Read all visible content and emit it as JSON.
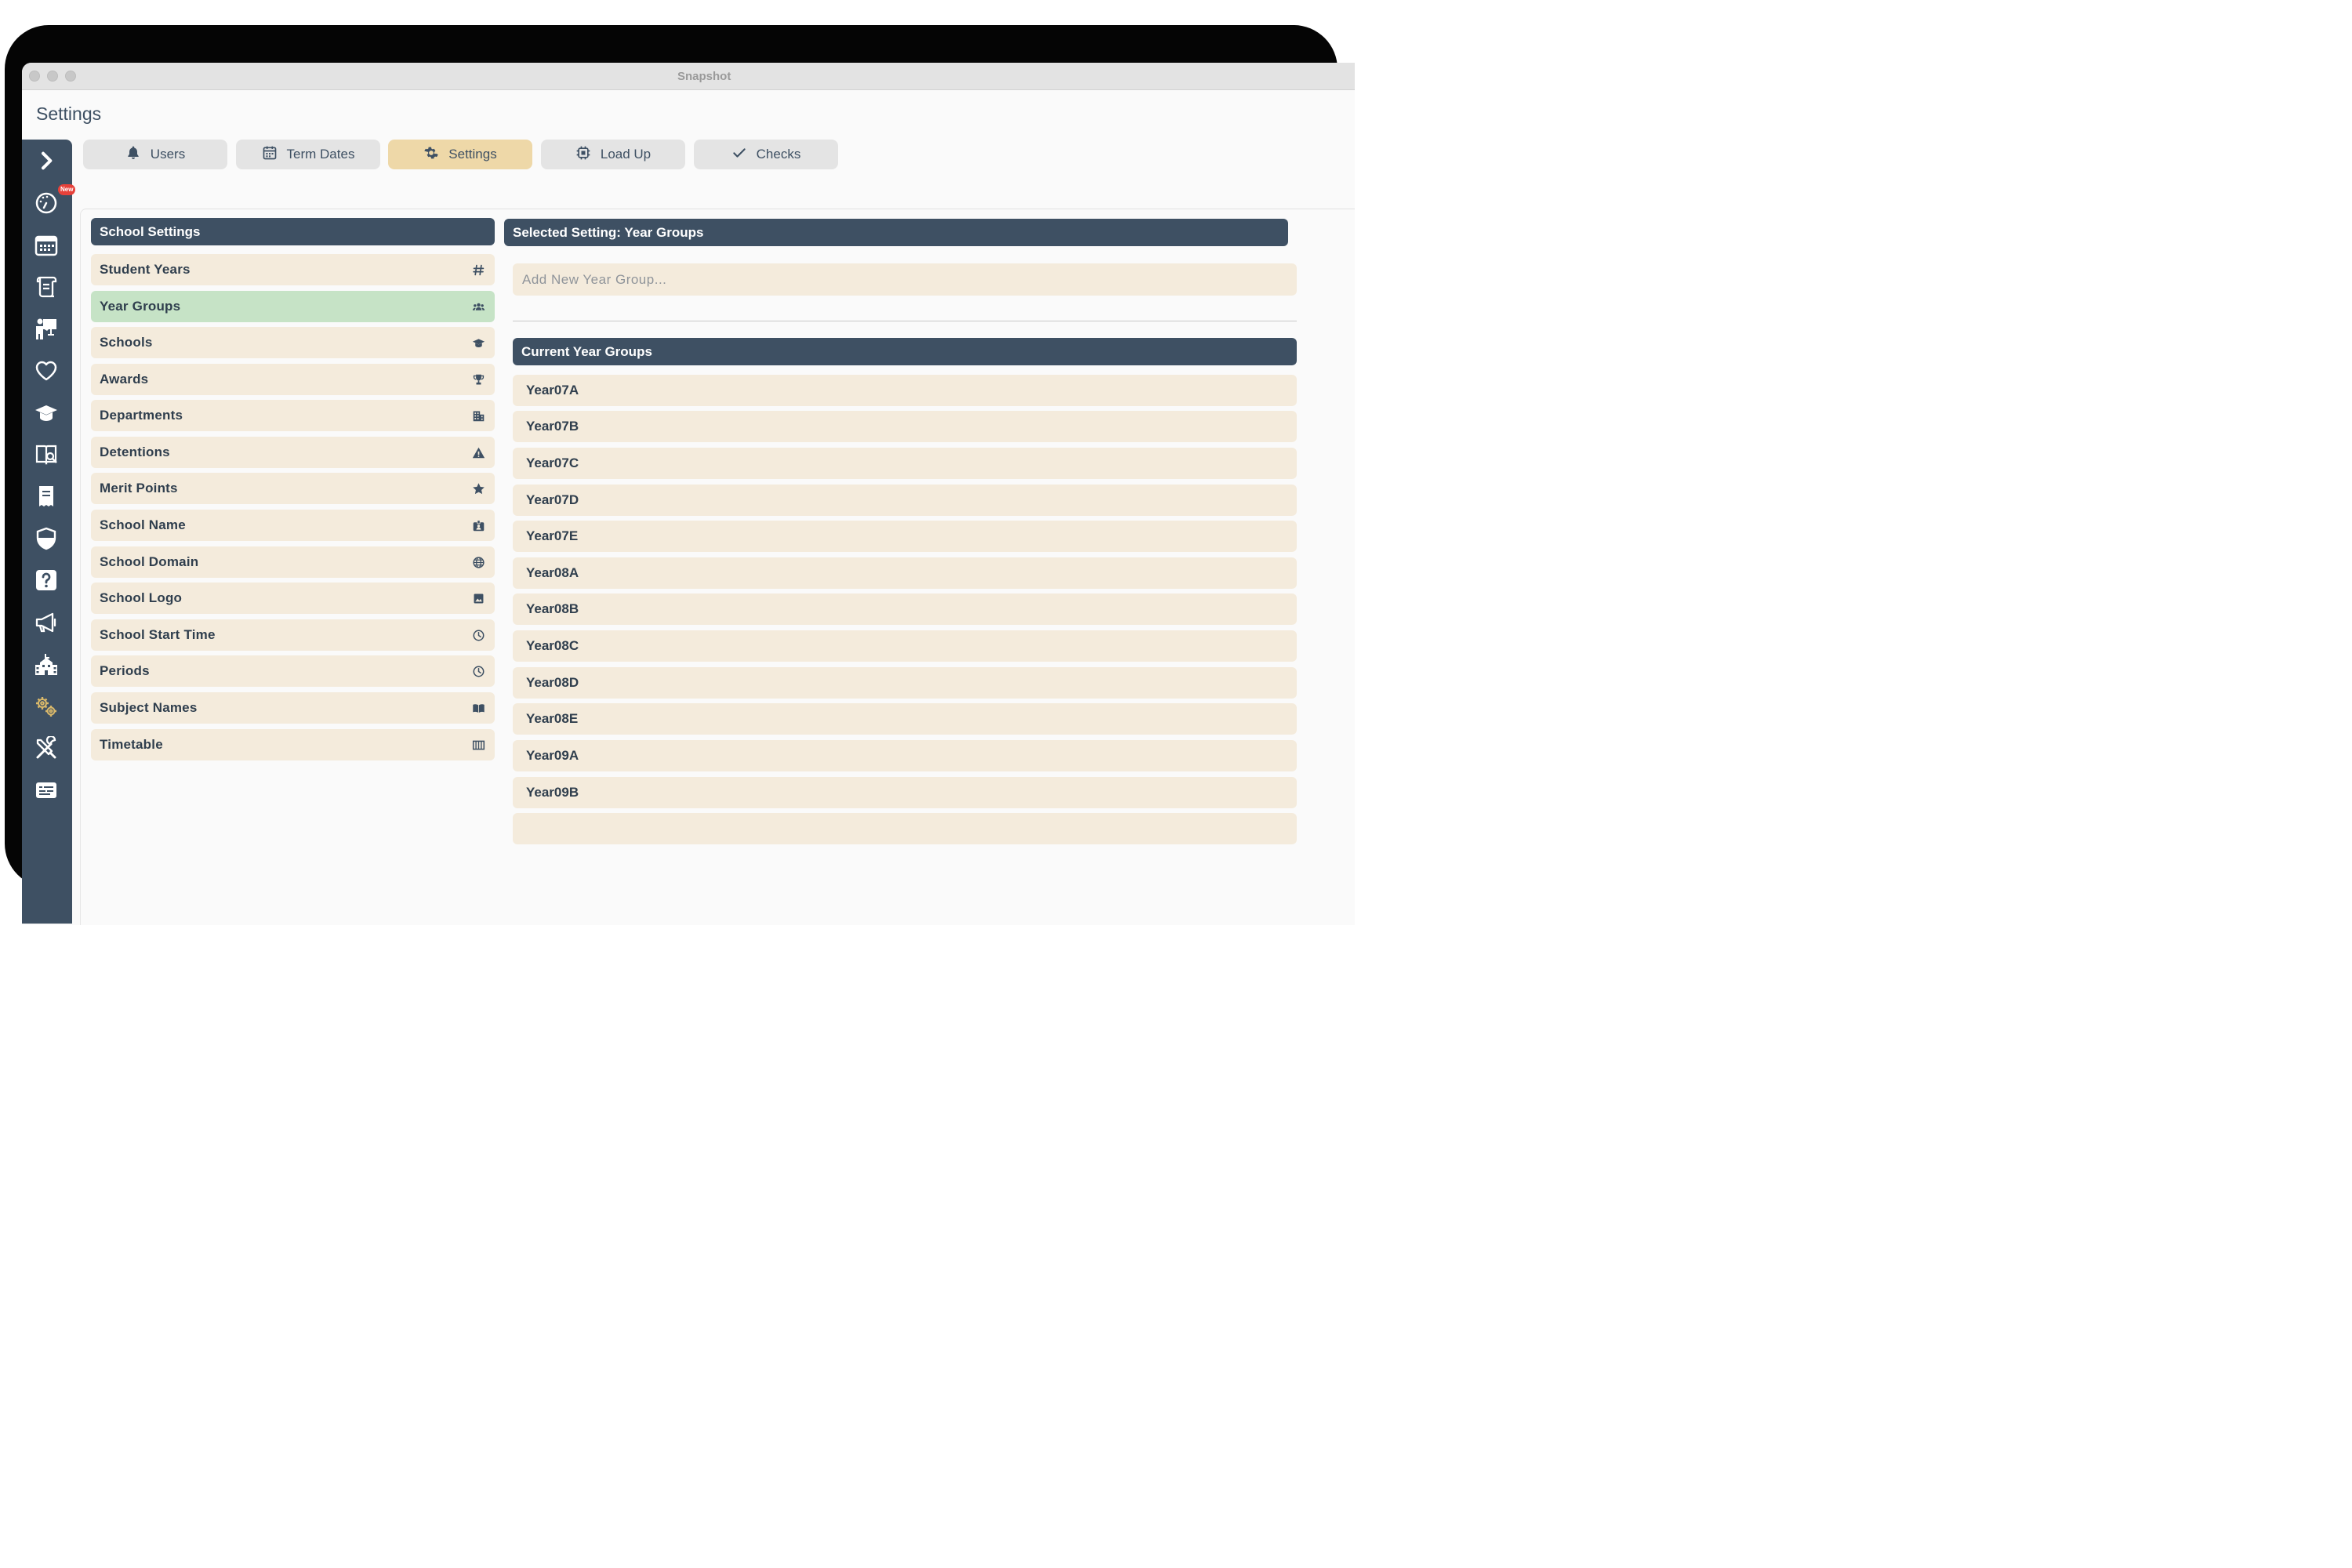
{
  "window": {
    "title": "Snapshot"
  },
  "page": {
    "title": "Settings"
  },
  "sidebar": {
    "new_badge": "New",
    "icons": [
      "chevron-right-icon",
      "speedometer-icon",
      "calendar-grid-icon",
      "scroll-icon",
      "teacher-icon",
      "heart-icon",
      "graduation-cap-icon",
      "book-search-icon",
      "document-icon",
      "shield-icon",
      "question-icon",
      "megaphone-icon",
      "school-building-icon",
      "cogs-icon",
      "tools-icon",
      "id-card-icon"
    ]
  },
  "tabs": [
    {
      "label": "Users",
      "icon": "bell-icon"
    },
    {
      "label": "Term Dates",
      "icon": "calendar-icon"
    },
    {
      "label": "Settings",
      "icon": "gear-icon",
      "active": true
    },
    {
      "label": "Load Up",
      "icon": "chip-icon"
    },
    {
      "label": "Checks",
      "icon": "check-icon"
    }
  ],
  "school_settings": {
    "header": "School Settings",
    "items": [
      {
        "label": "Student Years",
        "icon": "hash-icon"
      },
      {
        "label": "Year Groups",
        "icon": "users-icon",
        "selected": true
      },
      {
        "label": "Schools",
        "icon": "graduation-cap-icon"
      },
      {
        "label": "Awards",
        "icon": "trophy-icon"
      },
      {
        "label": "Departments",
        "icon": "building-icon"
      },
      {
        "label": "Detentions",
        "icon": "warning-icon"
      },
      {
        "label": "Merit Points",
        "icon": "star-icon"
      },
      {
        "label": "School Name",
        "icon": "id-badge-icon"
      },
      {
        "label": "School Domain",
        "icon": "globe-icon"
      },
      {
        "label": "School Logo",
        "icon": "image-icon"
      },
      {
        "label": "School Start Time",
        "icon": "clock-icon"
      },
      {
        "label": "Periods",
        "icon": "clock-icon"
      },
      {
        "label": "Subject Names",
        "icon": "book-open-icon"
      },
      {
        "label": "Timetable",
        "icon": "table-columns-icon"
      }
    ]
  },
  "selected_setting": {
    "header": "Selected Setting: Year Groups",
    "add_placeholder": "Add New Year Group...",
    "current_header": "Current Year Groups",
    "year_groups": [
      "Year07A",
      "Year07B",
      "Year07C",
      "Year07D",
      "Year07E",
      "Year08A",
      "Year08B",
      "Year08C",
      "Year08D",
      "Year08E",
      "Year09A",
      "Year09B"
    ]
  },
  "colors": {
    "primary": "#3e5063",
    "item_bg": "#f4ebdc",
    "selected_item_bg": "#c6e3c6",
    "active_tab_bg": "#eed8a8",
    "badge": "#e7413a"
  }
}
